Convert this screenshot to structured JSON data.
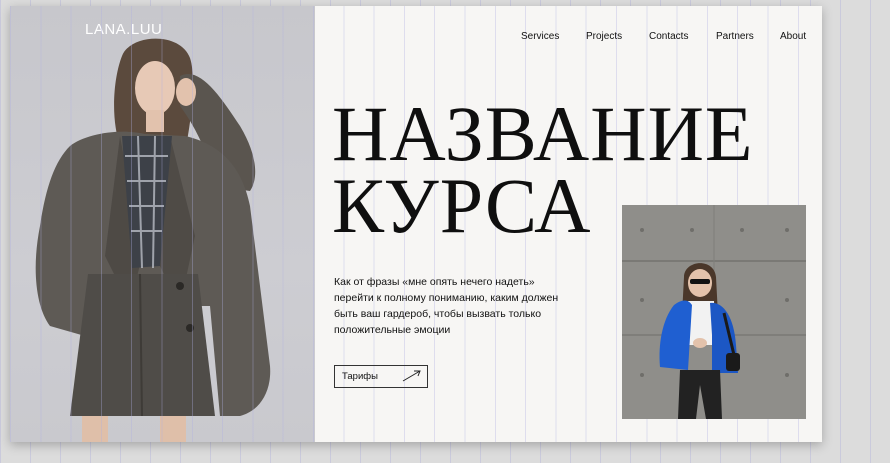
{
  "brand": "LANA.LUU",
  "nav": {
    "items": [
      "Services",
      "Projects",
      "Contacts",
      "Partners",
      "About"
    ]
  },
  "hero": {
    "title_line1": "НАЗВАНИЕ",
    "title_line2": "КУРСА",
    "description": "Как от фразы «мне опять нечего надеть» перейти к полному пониманию, каким должен быть ваш гардероб, чтобы вызвать только положительные эмоции",
    "cta_label": "Тарифы"
  },
  "icons": {
    "cta": "arrow-up-right-icon"
  },
  "colors": {
    "page_bg": "#f7f6f4",
    "text": "#0f0f0f",
    "left_photo_bg": "#c9c9ce",
    "right_photo_bg": "#8d8c88",
    "grid_lines": "#afafe1"
  }
}
